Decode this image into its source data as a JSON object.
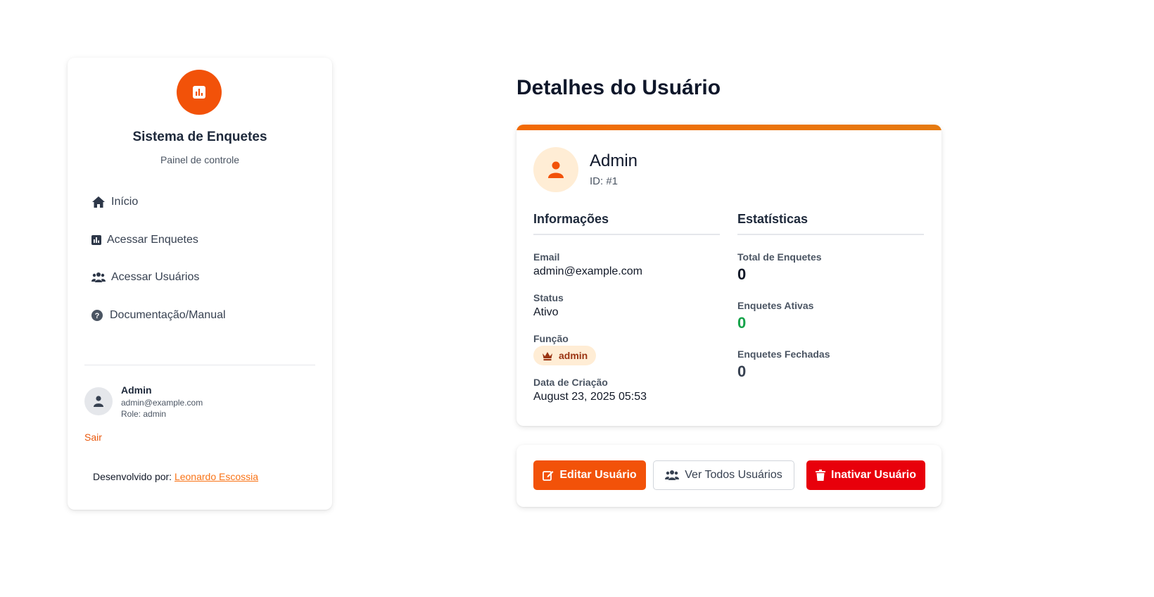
{
  "sidebar": {
    "app_title": "Sistema de Enquetes",
    "app_subtitle": "Painel de controle",
    "nav": [
      {
        "label": "Início",
        "icon": "home-icon"
      },
      {
        "label": "Acessar Enquetes",
        "icon": "chart-icon"
      },
      {
        "label": "Acessar Usuários",
        "icon": "users-icon"
      },
      {
        "label": "Documentação/Manual",
        "icon": "question-circle-icon"
      }
    ],
    "user": {
      "name": "Admin",
      "email": "admin@example.com",
      "role": "Role: admin"
    },
    "logout_label": "Sair",
    "footer": {
      "prefix": "Desenvolvido por:",
      "author": "Leonardo Escossia"
    }
  },
  "main": {
    "page_title": "Detalhes do Usuário",
    "profile": {
      "name": "Admin",
      "id": "ID: #1"
    },
    "info": {
      "title": "Informações",
      "email_label": "Email",
      "email_value": "admin@example.com",
      "status_label": "Status",
      "status_value": "Ativo",
      "role_label": "Função",
      "role_value": "admin",
      "created_label": "Data de Criação",
      "created_value": "August 23, 2025 05:53"
    },
    "stats": {
      "title": "Estatísticas",
      "total_label": "Total de Enquetes",
      "total_value": "0",
      "active_label": "Enquetes Ativas",
      "active_value": "0",
      "closed_label": "Enquetes Fechadas",
      "closed_value": "0"
    },
    "actions": {
      "edit_label": "Editar Usuário",
      "all_label": "Ver Todos Usuários",
      "deactivate_label": "Inativar Usuário"
    }
  },
  "colors": {
    "accent": "#f25209",
    "danger": "#e8000b",
    "success": "#16a34a"
  }
}
